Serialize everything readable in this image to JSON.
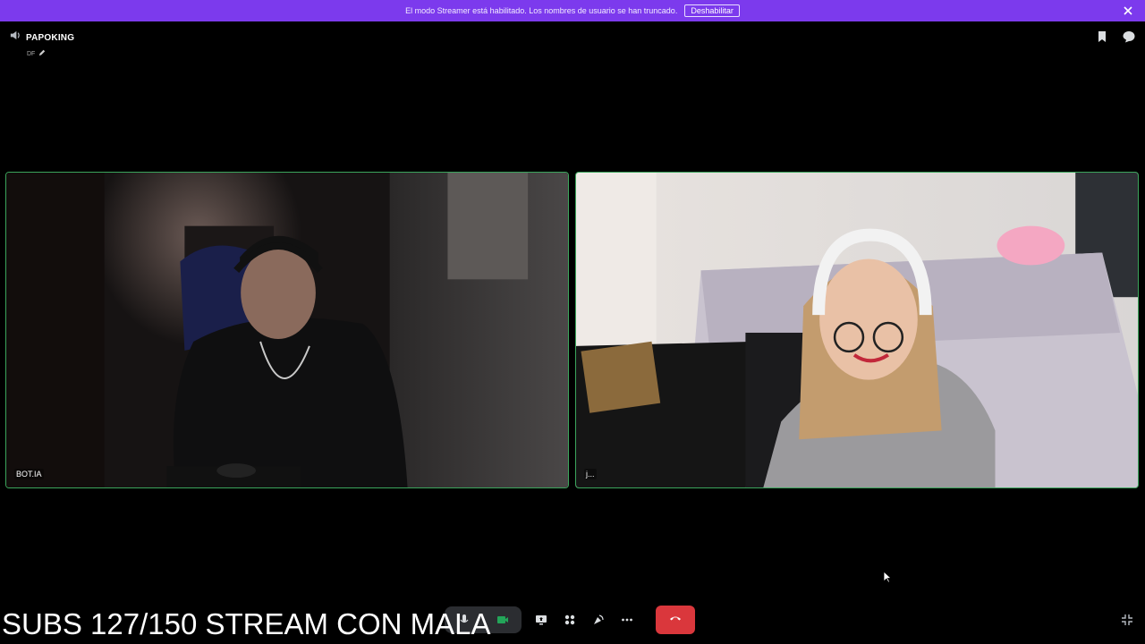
{
  "banner": {
    "message": "El modo Streamer está habilitado. Los nombres de usuario se han truncado.",
    "disable_label": "Deshabilitar",
    "color": "#7c3aed"
  },
  "channel": {
    "name": "PAPOKING",
    "sub": "DF",
    "icon": "speaker-icon"
  },
  "participants": [
    {
      "name": "BOT.IA",
      "speaking_border": "#3ba55c"
    },
    {
      "name": "j..."
    }
  ],
  "controls": {
    "items": [
      "mic-icon",
      "camera-icon",
      "screen-share-icon",
      "activities-icon",
      "soundboard-icon",
      "more-icon",
      "hangup-icon"
    ],
    "hangup_color": "#da373c"
  },
  "overlay": {
    "text": "SUBS 127/150  STREAM CON MALA"
  }
}
